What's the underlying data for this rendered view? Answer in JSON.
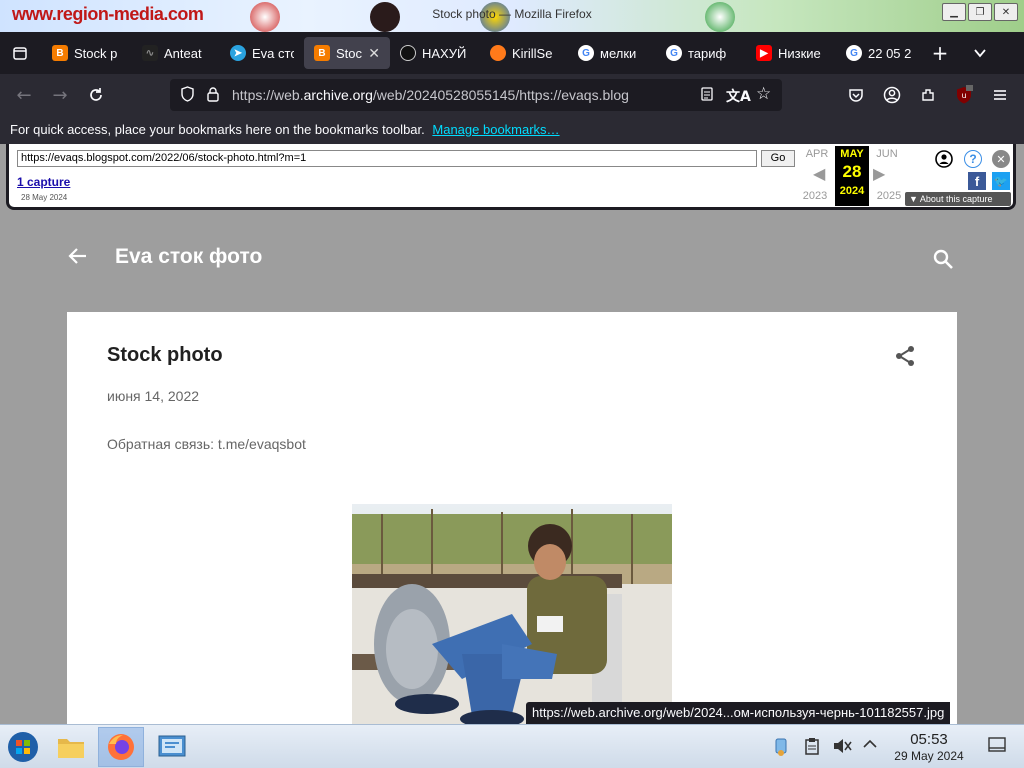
{
  "window": {
    "title": "Stock photo — Mozilla Firefox",
    "wallpaper_logo": "www.region-media.com"
  },
  "tabs": [
    {
      "label": "Stock р",
      "favicon": "blogger-icon",
      "color": "#f57c00"
    },
    {
      "label": "Anteat",
      "favicon": "anteater-icon",
      "color": "#222222"
    },
    {
      "label": "Eva сто",
      "favicon": "telegram-icon",
      "color": "#2aa3e0"
    },
    {
      "label": "Stock",
      "favicon": "blogger-icon",
      "color": "#f57c00",
      "active": true
    },
    {
      "label": "НАХУЙ",
      "favicon": "site-icon",
      "color": "#111111"
    },
    {
      "label": "KirillSe",
      "favicon": "orange-icon",
      "color": "#ff7a1a"
    },
    {
      "label": "мелки",
      "favicon": "google-icon",
      "color": "#ffffff"
    },
    {
      "label": "тариф",
      "favicon": "google-icon",
      "color": "#ffffff"
    },
    {
      "label": "Низкие",
      "favicon": "youtube-icon",
      "color": "#ff0000"
    },
    {
      "label": "22 05 2",
      "favicon": "google-icon",
      "color": "#ffffff"
    }
  ],
  "navbar": {
    "url_prefix": "https://web.",
    "url_host": "archive.org",
    "url_rest": "/web/20240528055145/https://evaqs.blog"
  },
  "bookmarks_bar": {
    "text": "For quick access, place your bookmarks here on the bookmarks toolbar.",
    "link": "Manage bookmarks…"
  },
  "wayback": {
    "url": "https://evaqs.blogspot.com/2022/06/stock-photo.html?m=1",
    "go": "Go",
    "captures": "1 capture",
    "capture_date": "28 May 2024",
    "prev_month": "APR",
    "cur_month": "MAY",
    "next_month": "JUN",
    "cur_day": "28",
    "prev_year": "2023",
    "cur_year": "2024",
    "next_year": "2025",
    "about": "About this capture"
  },
  "page": {
    "blog_title": "Eva сток фото",
    "post_title": "Stock photo",
    "post_date": "июня 14, 2022",
    "post_body": "Обратная связь: t.me/evaqsbot"
  },
  "status_link": "https://web.archive.org/web/2024...ом-используя-чернь-101182557.jpg",
  "taskbar": {
    "time": "05:53",
    "date": "29 May 2024"
  }
}
